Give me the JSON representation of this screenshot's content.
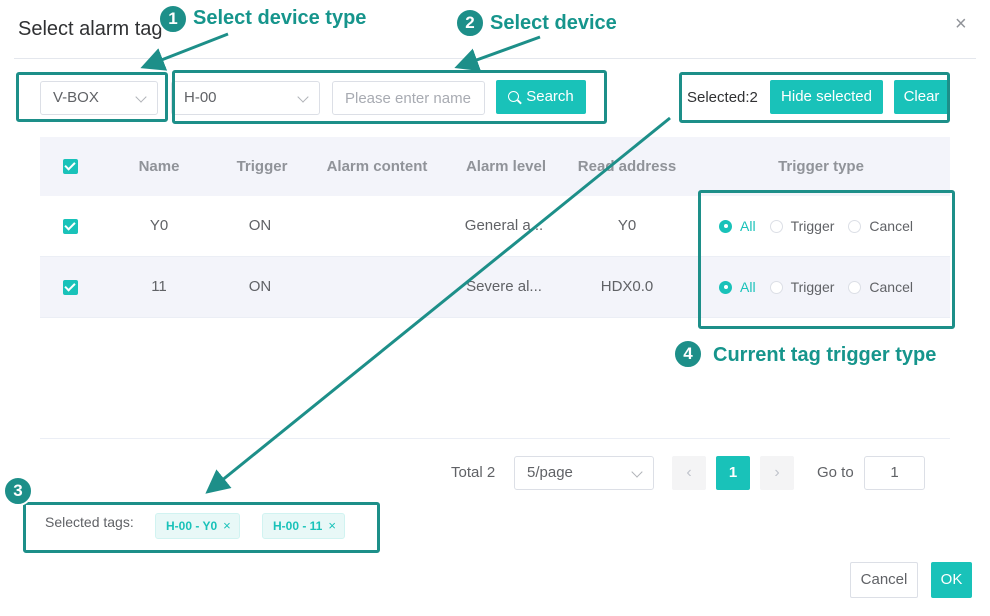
{
  "dialog": {
    "title": "Select alarm tag",
    "close": "×"
  },
  "filters": {
    "device_type": "V-BOX",
    "device": "H-00",
    "search_placeholder": "Please enter name",
    "search_label": "Search"
  },
  "selection": {
    "count_label": "Selected:2",
    "hide_label": "Hide selected",
    "clear_label": "Clear"
  },
  "table": {
    "headers": [
      "Name",
      "Trigger",
      "Alarm content",
      "Alarm level",
      "Read address",
      "Trigger type"
    ],
    "rows": [
      {
        "name": "Y0",
        "trigger": "ON",
        "content": "",
        "level": "General a...",
        "address": "Y0",
        "trigger_type": "All"
      },
      {
        "name": "11",
        "trigger": "ON",
        "content": "",
        "level": "Severe al...",
        "address": "HDX0.0",
        "trigger_type": "All"
      }
    ],
    "radio_options": [
      "All",
      "Trigger",
      "Cancel"
    ]
  },
  "pagination": {
    "total": "Total 2",
    "page_size": "5/page",
    "prev": "‹",
    "current": "1",
    "next": "›",
    "goto_label": "Go to",
    "goto_value": "1"
  },
  "selected_tags": {
    "label": "Selected tags:",
    "tags": [
      "H-00 - Y0",
      "H-00 - 11"
    ],
    "remove": "×"
  },
  "footer": {
    "cancel": "Cancel",
    "ok": "OK"
  },
  "annotations": [
    {
      "number": "1",
      "text": "Select device type"
    },
    {
      "number": "2",
      "text": "Select device"
    },
    {
      "number": "3",
      "text": ""
    },
    {
      "number": "4",
      "text": "Current tag trigger type"
    }
  ],
  "colors": {
    "accent": "#19c2b9",
    "annotation": "#1d8f89"
  }
}
